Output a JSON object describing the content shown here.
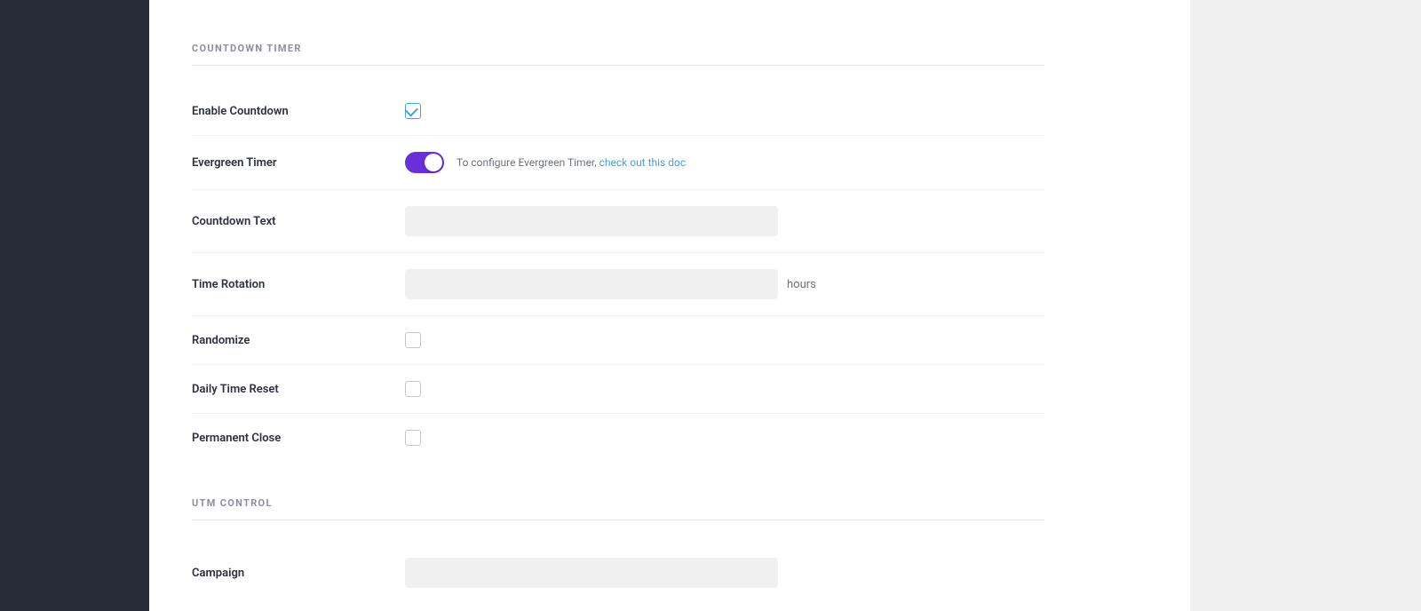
{
  "sidebar": {
    "bg": "#252d38"
  },
  "countdown_section": {
    "title": "COUNTDOWN TIMER",
    "fields": [
      {
        "id": "enable-countdown",
        "label": "Enable Countdown",
        "type": "checkbox",
        "checked": true
      },
      {
        "id": "evergreen-timer",
        "label": "Evergreen Timer",
        "type": "toggle",
        "enabled": true,
        "helper_text": "To configure Evergreen Timer, ",
        "link_text": "check out this doc",
        "link_href": "#"
      },
      {
        "id": "countdown-text",
        "label": "Countdown Text",
        "type": "text",
        "placeholder": "",
        "value": ""
      },
      {
        "id": "time-rotation",
        "label": "Time Rotation",
        "type": "text-with-suffix",
        "placeholder": "",
        "value": "",
        "suffix": "hours"
      },
      {
        "id": "randomize",
        "label": "Randomize",
        "type": "checkbox",
        "checked": false
      },
      {
        "id": "daily-time-reset",
        "label": "Daily Time Reset",
        "type": "checkbox",
        "checked": false
      },
      {
        "id": "permanent-close",
        "label": "Permanent Close",
        "type": "checkbox",
        "checked": false
      }
    ]
  },
  "utm_section": {
    "title": "UTM CONTROL",
    "fields": [
      {
        "id": "campaign",
        "label": "Campaign",
        "type": "text",
        "placeholder": "",
        "value": ""
      }
    ]
  }
}
